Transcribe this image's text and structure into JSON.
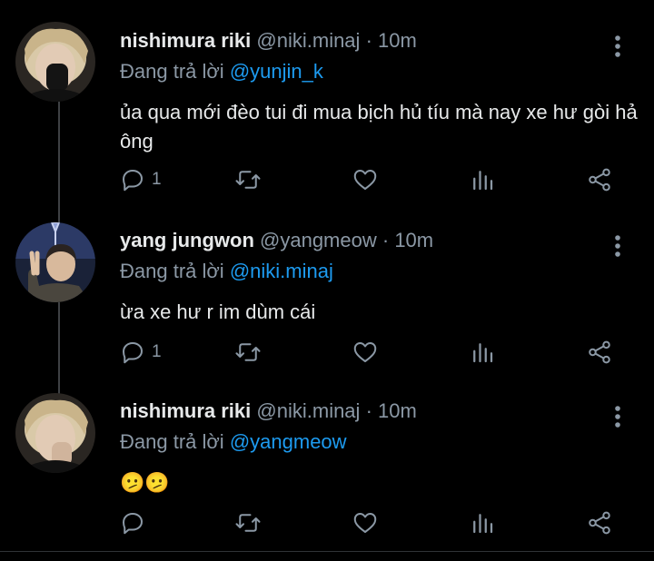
{
  "colors": {
    "background": "#000000",
    "text": "#e7e9ea",
    "secondary": "#8b98a5",
    "accent": "#1d9bf0"
  },
  "tweets": [
    {
      "name": "nishimura riki",
      "handle": "@niki.minaj",
      "time": "· 10m",
      "reply_prefix": "Đang trả lời",
      "reply_to": "@yunjin_k",
      "text": "ủa qua mới đèo tui đi mua bịch hủ tíu mà nay xe hư gòi hả ông",
      "reply_count": "1",
      "icons": [
        "reply-icon",
        "retweet-icon",
        "like-icon",
        "views-icon",
        "share-icon",
        "more-icon"
      ]
    },
    {
      "name": "yang jungwon",
      "handle": "@yangmeow",
      "time": "· 10m",
      "reply_prefix": "Đang trả lời",
      "reply_to": "@niki.minaj",
      "text": "ừa xe hư r im dùm cái",
      "reply_count": "1",
      "icons": [
        "reply-icon",
        "retweet-icon",
        "like-icon",
        "views-icon",
        "share-icon",
        "more-icon"
      ]
    },
    {
      "name": "nishimura riki",
      "handle": "@niki.minaj",
      "time": "· 10m",
      "reply_prefix": "Đang trả lời",
      "reply_to": "@yangmeow",
      "text": "🫤🫤",
      "reply_count": "",
      "icons": [
        "reply-icon",
        "retweet-icon",
        "like-icon",
        "views-icon",
        "share-icon",
        "more-icon"
      ]
    }
  ]
}
